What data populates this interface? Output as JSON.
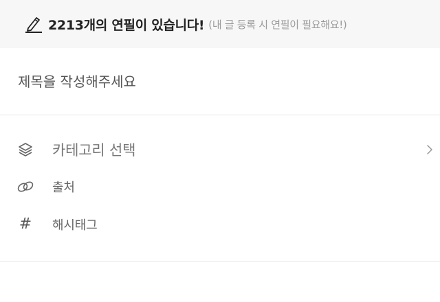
{
  "banner": {
    "pencil_icon": "pencil-icon",
    "count_text": "2213개의 연필이 있습니다!",
    "note_text": "(내 글 등록 시 연필이 필요해요!)"
  },
  "title": {
    "placeholder": "제목을 작성해주세요"
  },
  "options": {
    "category": {
      "icon": "layers-icon",
      "label": "카테고리 선택",
      "chevron": "chevron-right-icon"
    },
    "source": {
      "icon": "link-icon",
      "label": "출처"
    },
    "hashtag": {
      "icon": "hashtag-icon",
      "label": "해시태그",
      "glyph": "#"
    }
  }
}
